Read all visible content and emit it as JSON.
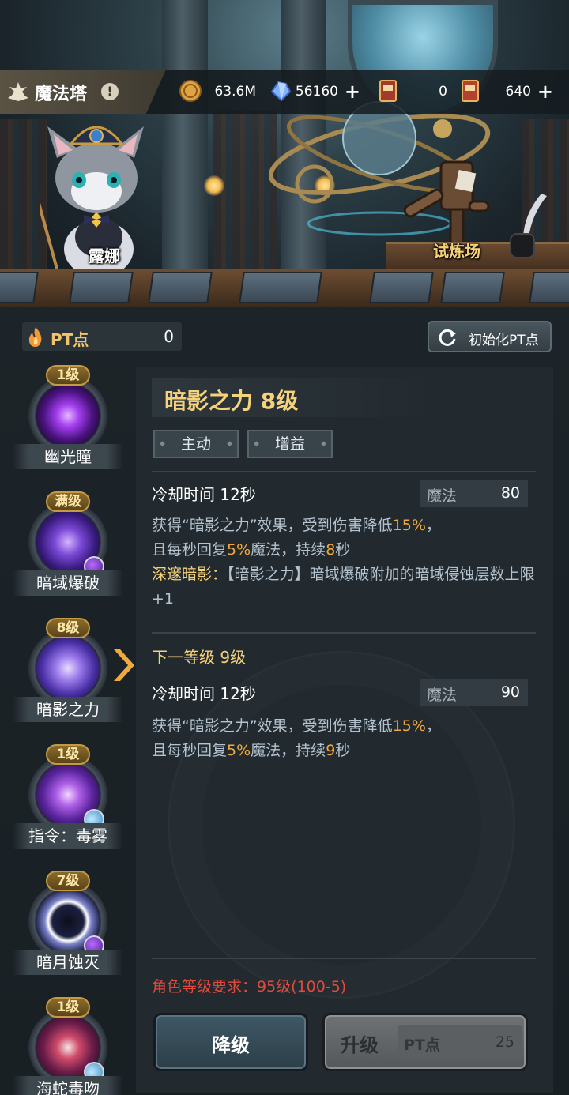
{
  "topbar": {
    "title": "魔法塔",
    "info_symbol": "!",
    "gold": "63.6M",
    "crystal": "56160",
    "ticket_a": "0",
    "ticket_b": "640",
    "plus": "+"
  },
  "scene": {
    "character_name": "露娜",
    "location_label": "试炼场"
  },
  "pt": {
    "label": "PT点",
    "value": "0",
    "reset_label": "初始化PT点"
  },
  "skills": [
    {
      "level": "1级",
      "name": "幽光瞳",
      "color": "#8b2fd4"
    },
    {
      "level": "满级",
      "name": "暗域爆破",
      "color": "#5a2aa8"
    },
    {
      "level": "8级",
      "name": "暗影之力",
      "color": "#6a3ec0"
    },
    {
      "level": "1级",
      "name": "指令：毒雾",
      "color": "#6c3aa6"
    },
    {
      "level": "7级",
      "name": "暗月蚀灭",
      "color": "#3b3f7a"
    },
    {
      "level": "1级",
      "name": "海蛇毒吻",
      "color": "#7a2a5a"
    }
  ],
  "detail": {
    "title": "暗影之力 8级",
    "tags": [
      "主动",
      "增益"
    ],
    "current": {
      "cooldown": "冷却时间 12秒",
      "mana_label": "魔法",
      "mana_value": "80",
      "line1_a": "获得“暗影之力”效果，受到伤害降低",
      "line1_b": "15%",
      "line1_c": "，",
      "line2_a": "且每秒回复",
      "line2_b": "5%",
      "line2_c": "魔法，持续",
      "line2_d": "8",
      "line2_e": "秒",
      "bonus_name": "深邃暗影：",
      "bonus_text": "【暗影之力】暗域爆破附加的暗域侵蚀层数上限+1"
    },
    "next": {
      "title": "下一等级 9级",
      "cooldown": "冷却时间 12秒",
      "mana_label": "魔法",
      "mana_value": "90",
      "line1_a": "获得“暗影之力”效果，受到伤害降低",
      "line1_b": "15%",
      "line1_c": "，",
      "line2_a": "且每秒回复",
      "line2_b": "5%",
      "line2_c": "魔法，持续",
      "line2_d": "9",
      "line2_e": "秒"
    },
    "requirement": "角色等级要求：95级(100-5)",
    "downgrade_label": "降级",
    "upgrade_label": "升级",
    "upgrade_cost_label": "PT点",
    "upgrade_cost_value": "25"
  }
}
